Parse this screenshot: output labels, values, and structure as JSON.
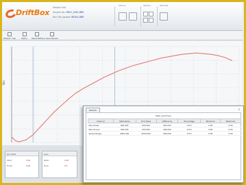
{
  "app": {
    "logo_text": "DriftBox",
    "session_label": "Session Info",
    "fields": [
      {
        "label": "Session No:",
        "value": "RR01_0001.BRR"
      },
      {
        "label": "Run File Loaded:",
        "value": "RR001.BRR"
      }
    ],
    "toolbar_groups": [
      "Actions",
      "Options",
      "Windows"
    ]
  },
  "subbar": {
    "items": [
      "Wheels / Slip",
      "Status",
      "Reset Pathline",
      "Save Results"
    ]
  },
  "chart": {
    "ylabel": "Nm",
    "x_ticks": [
      "",
      "",
      "",
      "",
      "",
      "",
      "",
      "",
      "",
      ""
    ],
    "y_ticks": [
      "",
      "",
      "",
      "",
      "",
      "",
      "",
      ""
    ],
    "colors": {
      "curve": "#e37a74",
      "grid": "#b9c4cf",
      "marker": "#9fb4c8",
      "axis": "#5d6772"
    }
  },
  "chart_data": {
    "type": "line",
    "series": [
      {
        "values_x": [
          0,
          5,
          10,
          20,
          30,
          40,
          50,
          60,
          70,
          80,
          90,
          100,
          110,
          120,
          130,
          140,
          150,
          160,
          170,
          180,
          190,
          200,
          210,
          220,
          230,
          240,
          250,
          260,
          270,
          280,
          290,
          300,
          310
        ],
        "values_y": [
          9,
          3,
          1,
          4,
          12,
          24,
          36,
          48,
          58,
          68,
          77,
          84,
          90,
          96,
          102,
          107,
          112,
          116,
          120,
          123,
          126,
          129,
          132,
          134,
          136,
          138,
          139,
          140,
          139,
          138,
          136,
          133,
          128
        ]
      }
    ],
    "xlim": [
      0,
      320
    ],
    "ylim": [
      0,
      150
    ],
    "grid": true
  },
  "bottom_left": {
    "box1": {
      "title": "Run Stats",
      "rows": [
        "Start",
        "Finish"
      ],
      "values": [
        "0.00",
        "0.00"
      ]
    },
    "box2": {
      "title": "Gear",
      "rows": [
        "Ratio",
        "Drop"
      ],
      "values": [
        "1.00",
        "0.0"
      ]
    }
  },
  "results": {
    "tab_label": "Results",
    "close_glyph": "×",
    "caption": "Peak_Summary",
    "columns": [
      "Channel",
      "Start Value",
      "End Value",
      "Difference",
      "Percentage",
      "Minimum",
      "Maximum"
    ],
    "rows": [
      [
        "Max Power",
        "000.000",
        "000.000",
        "000.000",
        "0.0%",
        "0.00",
        "0.00"
      ],
      [
        "Max Torque",
        "000.000",
        "000.000",
        "000.000",
        "0.0%",
        "0.00",
        "0.00"
      ],
      [
        "Speed Range",
        "0000.000",
        "0000.000",
        "000.000",
        "0.0%",
        "0.00",
        "0.00"
      ]
    ]
  }
}
